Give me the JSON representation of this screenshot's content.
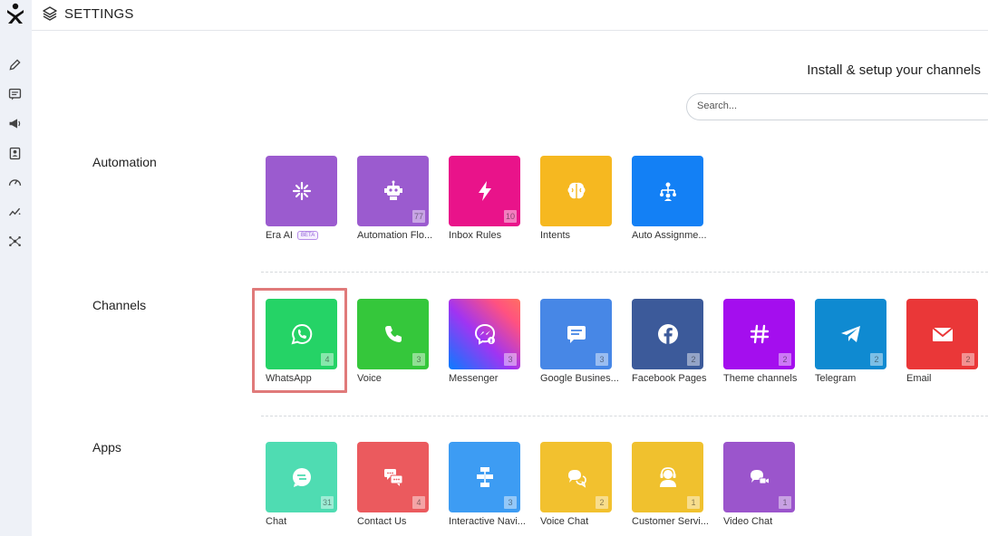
{
  "header": {
    "title": "SETTINGS"
  },
  "main": {
    "heading": "Install & setup your channels",
    "search": {
      "placeholder": "Search..."
    }
  },
  "colors": {
    "sidebar_bg": "#eef1f7",
    "highlight_border": "#e07a7a"
  },
  "sections": [
    {
      "label": "Automation",
      "tiles": [
        {
          "label": "Era AI",
          "badge": "BETA",
          "color": "#9b5bcf",
          "icon": "sparkle-icon"
        },
        {
          "label": "Automation Flo...",
          "count": "77",
          "color": "#9b5bcf",
          "icon": "robot-icon"
        },
        {
          "label": "Inbox Rules",
          "count": "10",
          "color": "#e9138a",
          "icon": "lightning-icon"
        },
        {
          "label": "Intents",
          "color": "#f6b820",
          "icon": "brain-icon"
        },
        {
          "label": "Auto Assignme...",
          "color": "#1380f5",
          "icon": "org-chart-icon"
        }
      ]
    },
    {
      "label": "Channels",
      "tiles": [
        {
          "label": "WhatsApp",
          "count": "4",
          "color": "#25d366",
          "icon": "whatsapp-icon"
        },
        {
          "label": "Voice",
          "count": "3",
          "color": "#35c73b",
          "icon": "phone-icon"
        },
        {
          "label": "Messenger",
          "count": "3",
          "color": "#a034f2",
          "icon": "messenger-icon"
        },
        {
          "label": "Google Busines...",
          "count": "3",
          "color": "#4787e6",
          "icon": "message-icon"
        },
        {
          "label": "Facebook Pages",
          "count": "2",
          "color": "#3c5a9a",
          "icon": "facebook-icon"
        },
        {
          "label": "Theme channels",
          "count": "2",
          "color": "#a40eee",
          "icon": "hash-icon"
        },
        {
          "label": "Telegram",
          "count": "2",
          "color": "#0f8ad1",
          "icon": "telegram-icon"
        },
        {
          "label": "Email",
          "count": "2",
          "color": "#ea3738",
          "icon": "mail-icon"
        }
      ]
    },
    {
      "label": "Apps",
      "tiles": [
        {
          "label": "Chat",
          "count": "31",
          "color": "#4fdcb2",
          "icon": "chat-icon"
        },
        {
          "label": "Contact Us",
          "count": "4",
          "color": "#eb5a5e",
          "icon": "contact-icon"
        },
        {
          "label": "Interactive Navi...",
          "count": "3",
          "color": "#3d9cf3",
          "icon": "flow-icon"
        },
        {
          "label": "Voice Chat",
          "count": "2",
          "color": "#f2c12f",
          "icon": "voice-chat-icon"
        },
        {
          "label": "Customer Servi...",
          "count": "1",
          "color": "#f0c12e",
          "icon": "agent-icon"
        },
        {
          "label": "Video Chat",
          "count": "1",
          "color": "#9b55cc",
          "icon": "video-chat-icon"
        }
      ]
    }
  ]
}
